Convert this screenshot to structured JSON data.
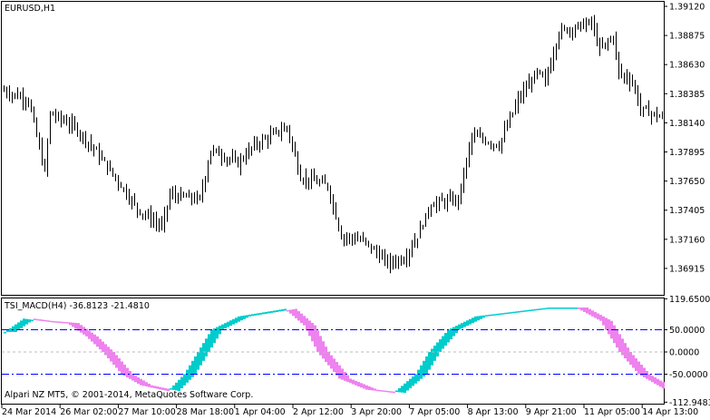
{
  "main_chart": {
    "title": "EURUSD,H1",
    "price_ticks": [
      "1.39120",
      "1.38875",
      "1.38630",
      "1.38385",
      "1.38140",
      "1.37895",
      "1.37650",
      "1.37405",
      "1.37160",
      "1.36915"
    ],
    "price_max": 1.3912,
    "price_min": 1.36915,
    "bars_count": 243,
    "price_anchors": [
      [
        0,
        1.3841
      ],
      [
        9,
        1.38334
      ],
      [
        15,
        1.37724
      ],
      [
        17,
        1.3822
      ],
      [
        26,
        1.38105
      ],
      [
        32,
        1.37953
      ],
      [
        42,
        1.37647
      ],
      [
        49,
        1.37418
      ],
      [
        58,
        1.37266
      ],
      [
        61,
        1.37533
      ],
      [
        72,
        1.37495
      ],
      [
        76,
        1.37915
      ],
      [
        86,
        1.378
      ],
      [
        92,
        1.37953
      ],
      [
        104,
        1.38105
      ],
      [
        109,
        1.37686
      ],
      [
        119,
        1.37609
      ],
      [
        124,
        1.3719
      ],
      [
        132,
        1.37151
      ],
      [
        141,
        1.36961
      ],
      [
        147,
        1.36999
      ],
      [
        152,
        1.3719
      ],
      [
        157,
        1.37457
      ],
      [
        167,
        1.37495
      ],
      [
        172,
        1.38029
      ],
      [
        182,
        1.37953
      ],
      [
        189,
        1.38334
      ],
      [
        196,
        1.38563
      ],
      [
        199,
        1.38487
      ],
      [
        204,
        1.38906
      ],
      [
        216,
        1.38983
      ],
      [
        219,
        1.38754
      ],
      [
        224,
        1.38868
      ],
      [
        226,
        1.38563
      ],
      [
        231,
        1.38487
      ],
      [
        234,
        1.38258
      ],
      [
        242,
        1.38181
      ]
    ]
  },
  "indicator": {
    "title": "TSI_MACD(H4) -36.8123 -21.4810",
    "scale_ticks": [
      "119.6500",
      "50.0000",
      "0.0000",
      "-50.0000",
      "-112.9483"
    ],
    "levels": [
      50,
      0,
      -50
    ],
    "rising_color": "#00cccc",
    "falling_color": "#ee82ee",
    "level_color": "#0000ff",
    "anchors": [
      [
        0,
        45
      ],
      [
        7,
        75
      ],
      [
        13,
        70
      ],
      [
        23,
        65
      ],
      [
        30,
        35
      ],
      [
        36,
        0
      ],
      [
        43,
        -50
      ],
      [
        50,
        -75
      ],
      [
        60,
        -88
      ],
      [
        66,
        -50
      ],
      [
        71,
        0
      ],
      [
        76,
        50
      ],
      [
        86,
        80
      ],
      [
        103,
        97
      ],
      [
        110,
        60
      ],
      [
        115,
        0
      ],
      [
        123,
        -60
      ],
      [
        133,
        -85
      ],
      [
        143,
        -92
      ],
      [
        151,
        -50
      ],
      [
        156,
        0
      ],
      [
        163,
        50
      ],
      [
        173,
        80
      ],
      [
        200,
        100
      ],
      [
        210,
        100
      ],
      [
        219,
        70
      ],
      [
        226,
        0
      ],
      [
        233,
        -50
      ],
      [
        242,
        -82
      ]
    ]
  },
  "time_labels": [
    "24 Mar 2014",
    "26 Mar 02:00",
    "27 Mar 10:00",
    "28 Mar 18:00",
    "1 Apr 04:00",
    "2 Apr 12:00",
    "3 Apr 20:00",
    "7 Apr 05:00",
    "8 Apr 13:00",
    "9 Apr 21:00",
    "11 Apr 05:00",
    "14 Apr 13:00"
  ],
  "copyright": "Alpari NZ MT5, © 2001-2014, MetaQuotes Software Corp."
}
